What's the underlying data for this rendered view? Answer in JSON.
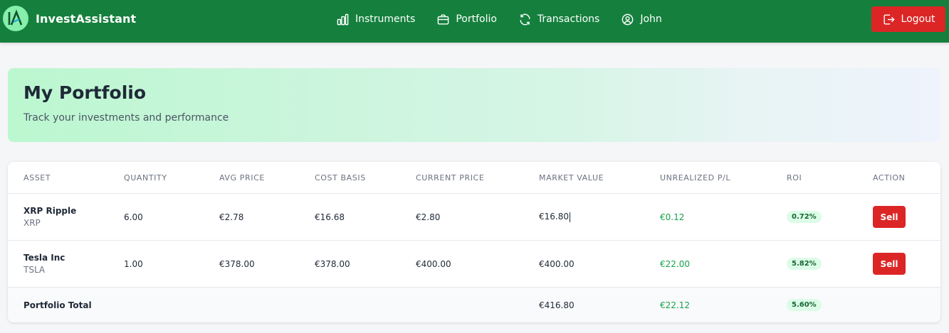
{
  "colors": {
    "nav": "#15803d",
    "danger": "#dc2626",
    "positive": "#16a34a"
  },
  "header": {
    "brand": "InvestAssistant",
    "nav": [
      {
        "label": "Instruments",
        "icon": "bar-chart-icon"
      },
      {
        "label": "Portfolio",
        "icon": "briefcase-icon"
      },
      {
        "label": "Transactions",
        "icon": "refresh-icon"
      },
      {
        "label": "John",
        "icon": "user-circle-icon"
      }
    ],
    "logout": "Logout"
  },
  "hero": {
    "title": "My Portfolio",
    "subtitle": "Track your investments and performance"
  },
  "table": {
    "columns": [
      "ASSET",
      "QUANTITY",
      "AVG PRICE",
      "COST BASIS",
      "CURRENT PRICE",
      "MARKET VALUE",
      "UNREALIZED P/L",
      "ROI",
      "ACTION"
    ],
    "rows": [
      {
        "name": "XRP Ripple",
        "symbol": "XRP",
        "quantity": "6.00",
        "avg_price": "€2.78",
        "cost_basis": "€16.68",
        "current_price": "€2.80",
        "market_value": "€16.80",
        "pl": "€0.12",
        "roi": "0.72%",
        "action": "Sell"
      },
      {
        "name": "Tesla Inc",
        "symbol": "TSLA",
        "quantity": "1.00",
        "avg_price": "€378.00",
        "cost_basis": "€378.00",
        "current_price": "€400.00",
        "market_value": "€400.00",
        "pl": "€22.00",
        "roi": "5.82%",
        "action": "Sell"
      }
    ],
    "total": {
      "label": "Portfolio Total",
      "market_value": "€416.80",
      "pl": "€22.12",
      "roi": "5.60%"
    }
  }
}
